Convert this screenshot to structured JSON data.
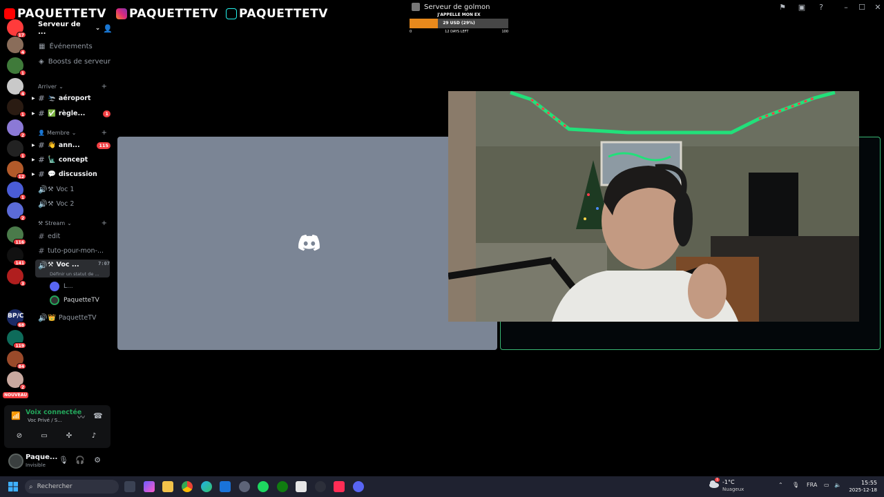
{
  "overlay": {
    "youtube_handle": "PAQUETTETV",
    "instagram_handle": "PAQUETTETV",
    "tiktok_handle": "PAQUETTETV"
  },
  "titlebar": {
    "server_name": "Serveur de golmon"
  },
  "goal": {
    "title": "J'APPELLE MON EX",
    "amount": "29 USD (29%)",
    "progress": 0.29,
    "min": "0",
    "days_left": "12 DAYS LEFT",
    "max": "100"
  },
  "rail": {
    "servers": [
      {
        "badge": "17",
        "color": "#ff3b3b"
      },
      {
        "badge": "4",
        "color": "#8a6d5a"
      },
      {
        "badge": "1",
        "color": "#3f7a3a"
      },
      {
        "badge": "4",
        "color": "#c9c9c9"
      },
      {
        "badge": "1",
        "color": "#2a1b12"
      },
      {
        "badge": "2",
        "color": "#8b79d6"
      },
      {
        "badge": "1",
        "color": "#222222"
      },
      {
        "badge": "12",
        "color": "#b25a2a"
      },
      {
        "badge": "1",
        "color": "#4a5cd6"
      },
      {
        "badge": "2",
        "color": "#5b6bd8"
      },
      {
        "badge": "116",
        "color": "#4a7a4a"
      },
      {
        "badge": "141",
        "color": "#111111"
      },
      {
        "badge": "3",
        "color": "#b01e1e"
      },
      {
        "badge": "68",
        "color": "#1b2b66"
      },
      {
        "badge": "119",
        "color": "#0e6b5a"
      },
      {
        "badge": "84",
        "color": "#9a4a2a"
      },
      {
        "badge": "2",
        "color": "#c9a9a0"
      }
    ],
    "bpc_label": "BP/C",
    "new_label": "NOUVEAU"
  },
  "sidebar": {
    "server_name": "Serveur de ...",
    "events_label": "Événements",
    "boosts_label": "Boosts de serveur",
    "categories": [
      {
        "label": "Arriver"
      },
      {
        "label": "Membre"
      },
      {
        "label": "Stream"
      }
    ],
    "channels": [
      {
        "emoji": "🛬",
        "label": "aéroport",
        "badge": ""
      },
      {
        "emoji": "✅",
        "label": "règle...",
        "badge": "1"
      },
      {
        "emoji": "👋",
        "label": "ann...",
        "badge": "115"
      },
      {
        "emoji": "🗽",
        "label": "concept",
        "badge": ""
      },
      {
        "emoji": "💬",
        "label": "discussion",
        "badge": ""
      },
      {
        "label": "Voc 1"
      },
      {
        "label": "Voc 2"
      },
      {
        "label": "edit"
      },
      {
        "label": "tuto-pour-mon-..."
      },
      {
        "label": "Voc ...",
        "time": "7:07",
        "status": "Définir un statut de ..."
      },
      {
        "label": "PaquetteTV"
      }
    ],
    "voice_users": [
      {
        "name": "L..."
      },
      {
        "name": "PaquetteTV"
      }
    ]
  },
  "voice_panel": {
    "status": "Voix connectée",
    "channel": "Voc Privé / S..."
  },
  "user_panel": {
    "name": "Paque...",
    "status": "Invisible"
  },
  "taskbar": {
    "search_placeholder": "Rechercher",
    "weather_temp": "-1°C",
    "weather_cond": "Nuageux",
    "weather_badge": "1",
    "language": "FRA",
    "time": "15:55",
    "date": "2025-12-18"
  }
}
